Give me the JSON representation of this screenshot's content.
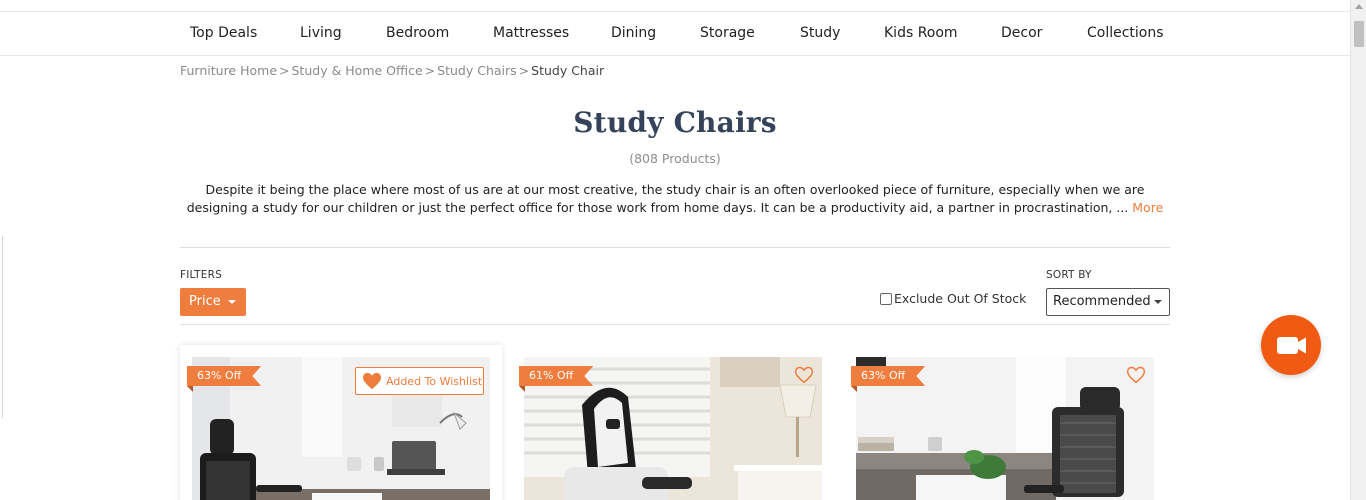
{
  "nav": {
    "items": [
      "Top Deals",
      "Living",
      "Bedroom",
      "Mattresses",
      "Dining",
      "Storage",
      "Study",
      "Kids Room",
      "Decor",
      "Collections"
    ]
  },
  "breadcrumb": {
    "items": [
      "Furniture Home",
      "Study & Home Office",
      "Study Chairs"
    ],
    "separator": ">",
    "current": "Study Chair"
  },
  "page": {
    "title": "Study Chairs",
    "count": "(808 Products)",
    "description": "Despite it being the place where most of us are at our most creative, the study chair is an often overlooked piece of furniture, especially when we are designing a study for our children or just the perfect office for those work from home days. It can be a productivity aid, a partner in procrastination, ...",
    "more_label": "More"
  },
  "filters": {
    "label": "FILTERS",
    "price_label": "Price",
    "exclude_label": "Exclude Out Of Stock",
    "exclude_checked": false
  },
  "sort": {
    "label": "SORT BY",
    "selected": "Recommended"
  },
  "products": [
    {
      "discount": "63% Off",
      "wishlist_label": "Added To Wishlist",
      "wishlisted": true
    },
    {
      "discount": "61% Off",
      "wishlisted": false
    },
    {
      "discount": "63% Off",
      "wishlisted": false
    }
  ],
  "colors": {
    "accent": "#ef7d3e",
    "title": "#34435a",
    "video_button": "#f05a12"
  },
  "icons": {
    "heart_filled": "heart-filled-icon",
    "heart_outline": "heart-outline-icon",
    "video": "video-camera-icon"
  }
}
